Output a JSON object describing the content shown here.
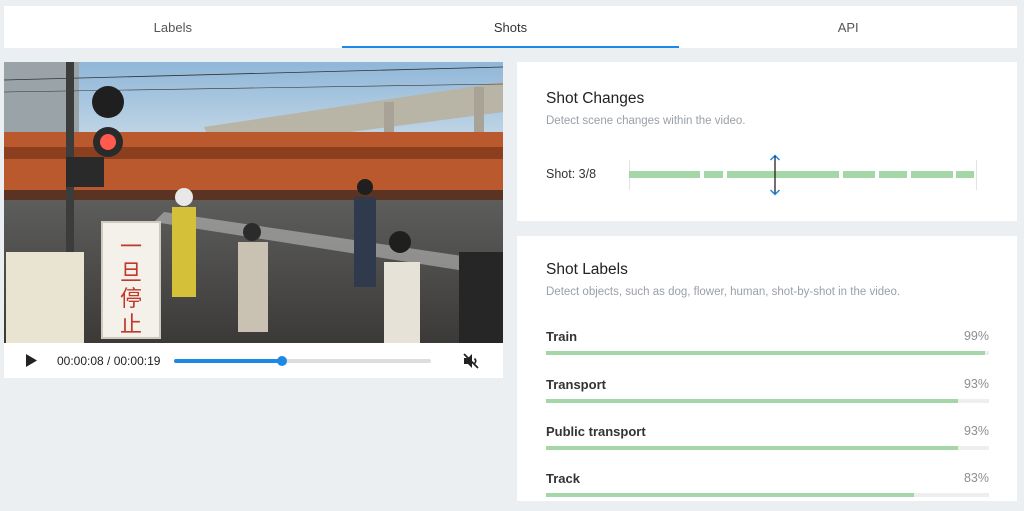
{
  "tabs": [
    {
      "label": "Labels",
      "active": false
    },
    {
      "label": "Shots",
      "active": true
    },
    {
      "label": "API",
      "active": false
    }
  ],
  "player": {
    "time_display": "00:00:08 / 00:00:19",
    "progress": 0.42,
    "muted": true,
    "sign_text": "一旦停止"
  },
  "shot_changes": {
    "title": "Shot Changes",
    "subtitle": "Detect scene changes within the video.",
    "shot_label": "Shot: 3/8",
    "current_shot": 3,
    "total_shots": 8,
    "marker_position": 0.42
  },
  "shot_labels": {
    "title": "Shot Labels",
    "subtitle": "Detect objects, such as dog, flower, human, shot-by-shot in the video.",
    "items": [
      {
        "name": "Train",
        "percent": "99%",
        "value": 0.99
      },
      {
        "name": "Transport",
        "percent": "93%",
        "value": 0.93
      },
      {
        "name": "Public transport",
        "percent": "93%",
        "value": 0.93
      },
      {
        "name": "Track",
        "percent": "83%",
        "value": 0.83
      }
    ]
  },
  "colors": {
    "accent": "#1e88e5",
    "bar": "#a5d6a7",
    "background": "#eceff1"
  }
}
